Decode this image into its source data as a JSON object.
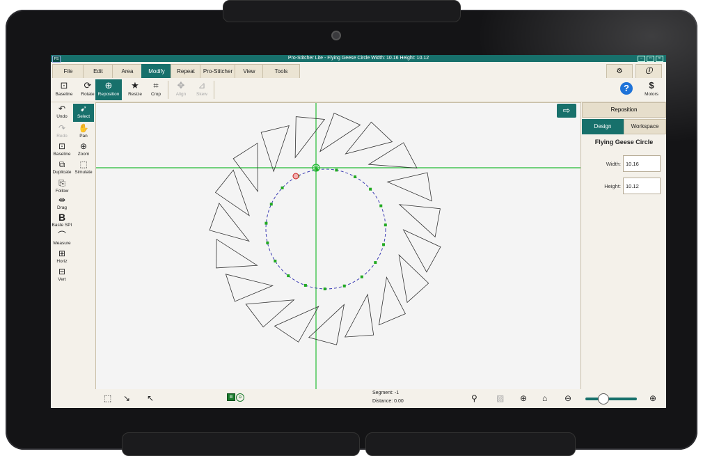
{
  "window": {
    "title": "Pro-Stitcher Lite  -  Flying Geese Circle   Width: 10.16   Height: 10.12",
    "logo": "PS",
    "controls": [
      "–",
      "□",
      "✕"
    ]
  },
  "menu": {
    "tabs": [
      "File",
      "Edit",
      "Area",
      "Modify",
      "Repeat",
      "Pro-Stitcher",
      "View",
      "Tools"
    ],
    "active": "Modify",
    "right_icons": [
      "settings-icon",
      "info-icon"
    ]
  },
  "toolbar": {
    "tools": [
      {
        "label": "Baseline",
        "icon": "baseline-icon",
        "glyph": "⊡"
      },
      {
        "label": "Rotate",
        "icon": "rotate-icon",
        "glyph": "⟳"
      },
      {
        "label": "Reposition",
        "icon": "reposition-icon",
        "glyph": "⊕"
      },
      {
        "label": "Resize",
        "icon": "resize-icon",
        "glyph": "★"
      },
      {
        "label": "Crop",
        "icon": "crop-icon",
        "glyph": "⌗"
      },
      {
        "label": "Align",
        "icon": "align-icon",
        "glyph": "✥"
      },
      {
        "label": "Skew",
        "icon": "skew-icon",
        "glyph": "⊿"
      }
    ],
    "help_glyph": "?",
    "motors_label": "Motors",
    "motors_glyph": "$"
  },
  "left_tools": {
    "items": [
      {
        "label": "Undo",
        "glyph": "↶"
      },
      {
        "label": "Select",
        "glyph": "➹"
      },
      {
        "label": "Redo",
        "glyph": "↷"
      },
      {
        "label": "Pan",
        "glyph": "✋"
      },
      {
        "label": "Baseline",
        "glyph": "⊡"
      },
      {
        "label": "Zoom",
        "glyph": "⊕"
      },
      {
        "label": "Duplicate",
        "glyph": "⧉"
      },
      {
        "label": "Simulate",
        "glyph": "⬚"
      },
      {
        "label": "Follow",
        "glyph": "⎘"
      },
      {
        "label": "Drag",
        "glyph": "⇹"
      },
      {
        "label": "Baste SPI",
        "glyph": "B"
      },
      {
        "label": "Measure",
        "glyph": "⌒"
      },
      {
        "label": "Horiz",
        "glyph": "⊞"
      },
      {
        "label": "Vert",
        "glyph": "⊟"
      }
    ]
  },
  "right_panel": {
    "header": "Reposition",
    "tabs": [
      "Design",
      "Workspace"
    ],
    "active_tab": "Design",
    "design_name": "Flying Geese Circle",
    "width_label": "Width:",
    "width_value": "10.16",
    "height_label": "Height:",
    "height_value": "10.12"
  },
  "status": {
    "segment_text": "Segment: -1",
    "distance_text": "Distance: 0.00",
    "zoom_level": 0.34,
    "icons": [
      "select-box-icon",
      "select-arrow-icon",
      "select-back-icon",
      "layer-icon",
      "node-icon",
      "sew-path-icon",
      "image-icon",
      "zoom-fit-icon",
      "home-icon",
      "zoom-out-icon",
      "zoom-in-icon"
    ]
  },
  "colors": {
    "accent": "#17706b",
    "crosshair": "#22bb33",
    "path": "#3c3cb4",
    "node": "#22aa22"
  },
  "design": {
    "triangle_count": 19,
    "center_marker": "green-crosshair",
    "start_marker": "red-x"
  }
}
